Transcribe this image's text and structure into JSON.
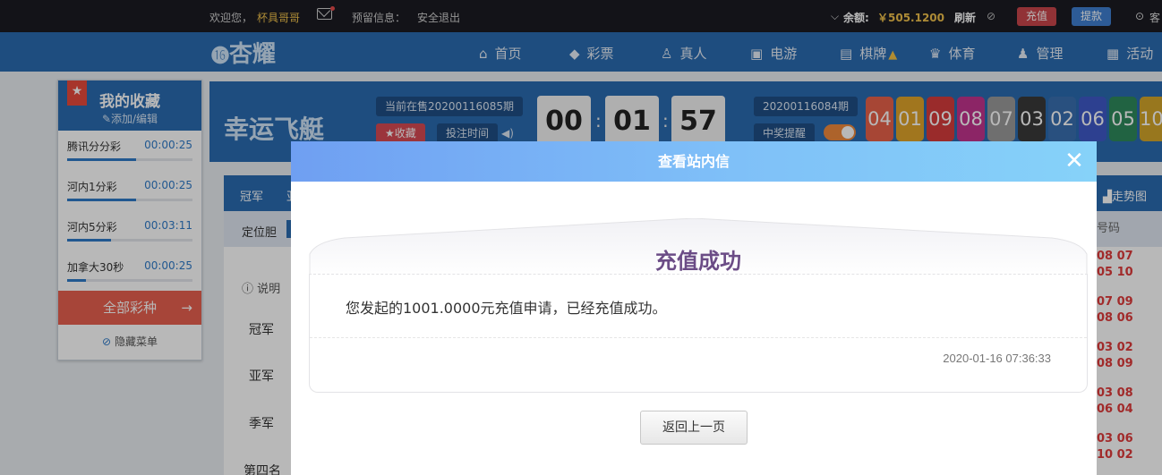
{
  "topbar": {
    "welcome": "欢迎您，",
    "username": "杯具哥哥",
    "reserve": "预留信息：",
    "logout": "安全退出",
    "balance_label": "余额:",
    "balance": "￥505.1200",
    "refresh": "刷新",
    "recharge": "充值",
    "withdraw": "提款",
    "service": "客"
  },
  "nav": {
    "logo": "杏耀",
    "items": [
      "首页",
      "彩票",
      "真人",
      "电游",
      "棋牌",
      "体育",
      "管理",
      "活动"
    ]
  },
  "favorites": {
    "title": "我的收藏",
    "edit": "添加/编辑",
    "items": [
      {
        "name": "腾讯分分彩",
        "time": "00:00:25",
        "progress": 0.55
      },
      {
        "name": "河内1分彩",
        "time": "00:00:25",
        "progress": 0.55
      },
      {
        "name": "河内5分彩",
        "time": "00:03:11",
        "progress": 0.35
      },
      {
        "name": "加拿大30秒",
        "time": "00:00:25",
        "progress": 0.15
      }
    ],
    "all_games": "全部彩种",
    "hide_menu": "隐藏菜单"
  },
  "lottery": {
    "logo": "幸运飞艇",
    "current_issue": "当前在售20200116085期",
    "fav_btn": "收藏",
    "bet_time": "投注时间",
    "timer": [
      "00",
      "01",
      "57"
    ],
    "last_issue": "20200116084期",
    "win_remind": "中奖提醒",
    "balls": [
      "04",
      "01",
      "09",
      "08",
      "07",
      "03",
      "02",
      "06",
      "05",
      "10"
    ],
    "ball_colors": [
      "#e8624a",
      "#e0a42a",
      "#d63c3c",
      "#c2348e",
      "#9a9a9a",
      "#3a3a3a",
      "#3a6fb0",
      "#3f59c8",
      "#2e8a5c",
      "#d3a52a"
    ]
  },
  "main": {
    "tabs": [
      "冠军",
      "亚"
    ],
    "sub": "定位胆",
    "note": "说明",
    "rows": [
      "冠军",
      "亚军",
      "季军",
      "第四名"
    ],
    "trend": "走势图",
    "hist_label": "号码",
    "hist": [
      "08 07",
      "05 10",
      "07 09",
      "08 06",
      "03 02",
      "08 09",
      "03 08",
      "06 04",
      "03 06",
      "10 02"
    ]
  },
  "modal": {
    "header": "查看站内信",
    "title": "充值成功",
    "message": "您发起的1001.0000元充值申请，已经充值成功。",
    "date": "2020-01-16 07:36:33",
    "back": "返回上一页"
  }
}
